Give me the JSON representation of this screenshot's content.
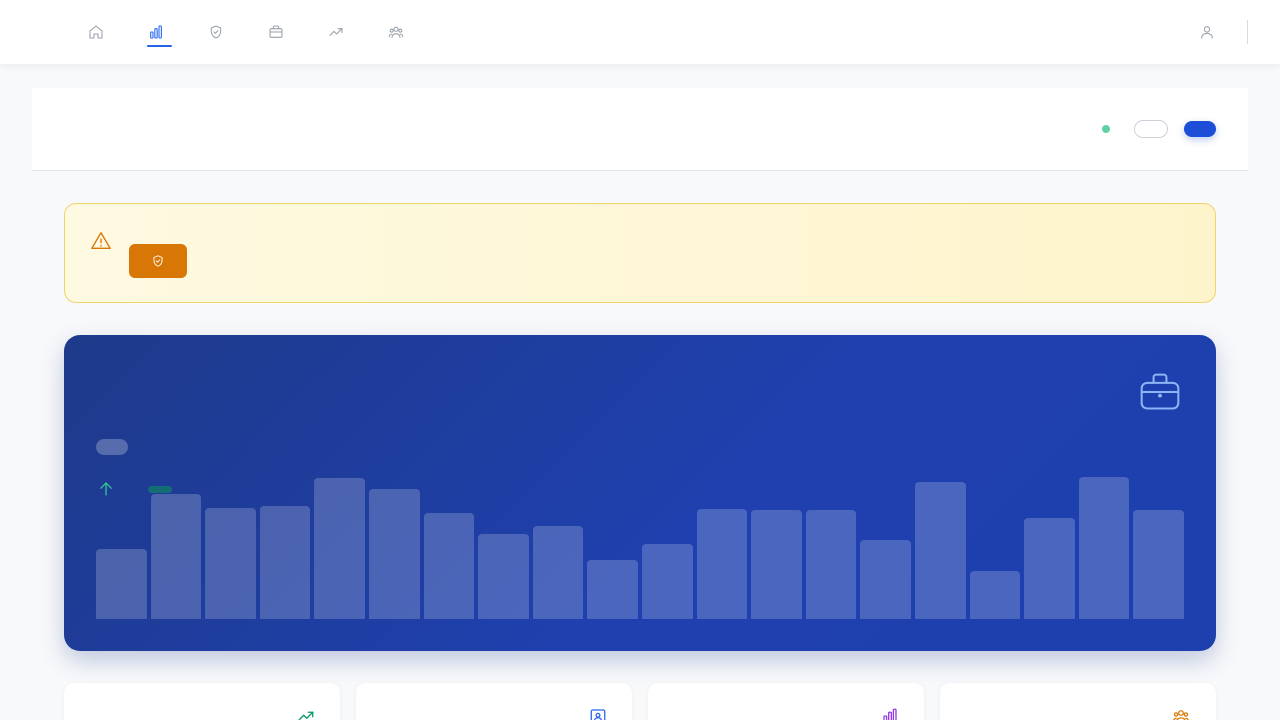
{
  "nav": {
    "items": [
      {
        "icon": "home-icon",
        "active": false
      },
      {
        "icon": "bar-chart-icon",
        "active": true
      },
      {
        "icon": "shield-check-icon",
        "active": false
      },
      {
        "icon": "briefcase-icon",
        "active": false
      },
      {
        "icon": "trending-up-icon",
        "active": false
      },
      {
        "icon": "users-icon",
        "active": false
      }
    ],
    "user_icon": "user-icon"
  },
  "header": {
    "status_color": "#5dd3a4",
    "secondary_button_label": "",
    "primary_button_label": ""
  },
  "alert": {
    "icon": "warning-triangle-icon",
    "button_icon": "shield-check-icon",
    "accent_color": "#d97706"
  },
  "hero": {
    "icon": "briefcase-icon",
    "trend_icon": "arrow-up-icon",
    "bar_levels": [
      0.5,
      0.89,
      0.79,
      0.8,
      1.0,
      0.92,
      0.75,
      0.6,
      0.66,
      0.42,
      0.53,
      0.78,
      0.77,
      0.77,
      0.56,
      0.97,
      0.34,
      0.72,
      1.01,
      0.77
    ]
  },
  "stats": [
    {
      "icon": "trending-up-icon",
      "color": "#059669"
    },
    {
      "icon": "id-card-icon",
      "color": "#2563eb"
    },
    {
      "icon": "bar-chart-icon",
      "color": "#9333ea"
    },
    {
      "icon": "users-icon",
      "color": "#d97706"
    }
  ],
  "colors": {
    "brand": "#2563eb",
    "hero_start": "#1e3a8a",
    "hero_end": "#1e40af",
    "warning": "#d97706"
  }
}
